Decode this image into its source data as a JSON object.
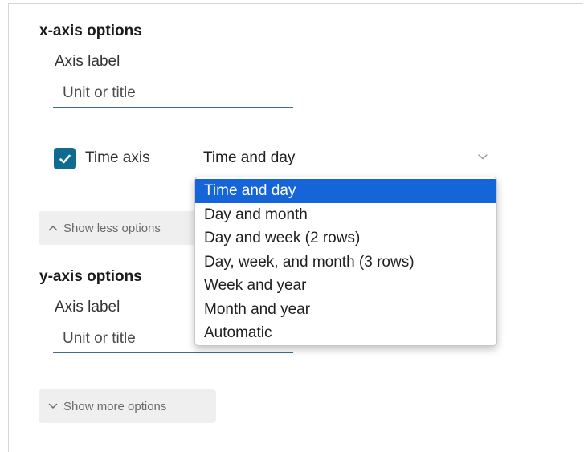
{
  "x_axis": {
    "title": "x-axis options",
    "axis_label": "Axis label",
    "input_placeholder": "Unit or title",
    "time_axis_checked": true,
    "time_axis_label": "Time axis",
    "time_format_value": "Time and day",
    "toggle_label": "Show less options",
    "toggle_icon": "chevron-up-icon"
  },
  "y_axis": {
    "title": "y-axis options",
    "axis_label": "Axis label",
    "input_placeholder": "Unit or title",
    "toggle_label": "Show more options",
    "toggle_icon": "chevron-down-icon"
  },
  "dropdown": {
    "selected_index": 0,
    "options": [
      "Time and day",
      "Day and month",
      "Day and week (2 rows)",
      "Day, week, and month (3 rows)",
      "Week and year",
      "Month and year",
      "Automatic"
    ]
  },
  "colors": {
    "checkbox": "#0f6b8f",
    "input_underline": "#3f6d86",
    "selected_option": "#1565d8"
  }
}
